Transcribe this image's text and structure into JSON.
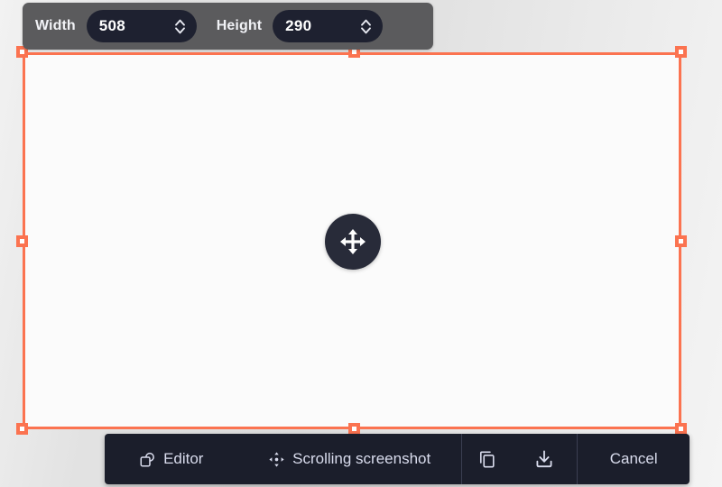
{
  "size_toolbar": {
    "width": {
      "label": "Width",
      "value": "508",
      "stepper_icon": "up-down-chevron-icon"
    },
    "height": {
      "label": "Height",
      "value": "290",
      "stepper_icon": "up-down-chevron-icon"
    }
  },
  "selection": {
    "move_handle_icon": "move-arrows-icon",
    "accent_color": "#fb7350",
    "fill_color": "#fbfbfb",
    "handle_count": 8
  },
  "action_toolbar": {
    "background_color": "#1b1e2b",
    "buttons": [
      {
        "id": "editor",
        "label": "Editor",
        "icon": "shapes-icon"
      },
      {
        "id": "scrolling-screenshot",
        "label": "Scrolling screenshot",
        "icon": "move-arrows-icon"
      },
      {
        "id": "copy",
        "label": "",
        "icon": "copy-icon"
      },
      {
        "id": "save",
        "label": "",
        "icon": "download-icon"
      },
      {
        "id": "cancel",
        "label": "Cancel",
        "icon": ""
      }
    ]
  }
}
